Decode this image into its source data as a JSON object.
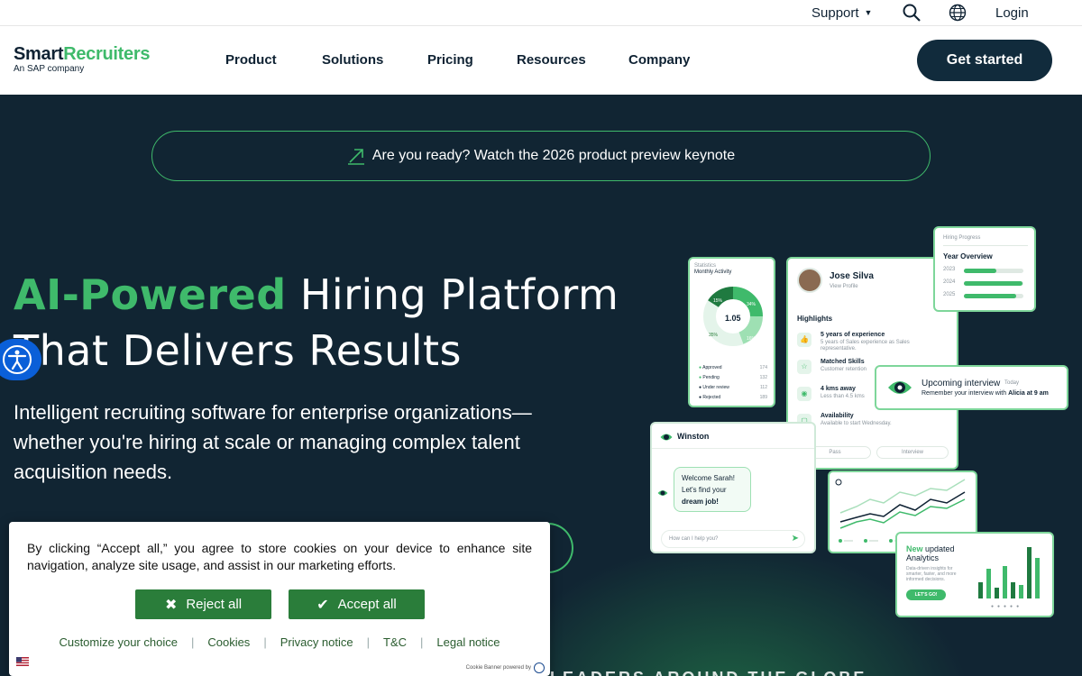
{
  "utility": {
    "support": "Support",
    "login": "Login"
  },
  "logo": {
    "part1": "Smart",
    "part2": "Recruiters",
    "tagline": "An SAP company"
  },
  "nav": {
    "items": [
      "Product",
      "Solutions",
      "Pricing",
      "Resources",
      "Company"
    ],
    "cta": "Get started"
  },
  "hero": {
    "banner": "Are you ready? Watch the 2026 product preview keynote",
    "headline_green": "AI-Powered",
    "headline_rest": " Hiring Platform",
    "headline_line2": "That Delivers Results",
    "subtitle": "Intelligent recruiting software for enterprise organizations—whether you're hiring at scale or managing complex talent acquisition needs.",
    "stats_peek": "LEADERS AROUND THE GLOBE"
  },
  "illustration": {
    "stat": {
      "label": "Statistics",
      "title": "Monthly Activity",
      "center_value": "1.05",
      "center_sub": "Relevance stack",
      "segments": [
        "15%",
        "34%",
        "35%",
        "16%"
      ],
      "rows": [
        {
          "label": "Approved",
          "value": "174"
        },
        {
          "label": "Pending",
          "value": "132"
        },
        {
          "label": "Under review",
          "value": "112"
        },
        {
          "label": "Rejected",
          "value": "189"
        }
      ]
    },
    "profile": {
      "name": "Jose Silva",
      "view": "View Profile",
      "highlights_title": "Highlights",
      "items": [
        {
          "title": "5 years of experience",
          "desc": "5 years of Sales experience as Sales representative."
        },
        {
          "title": "Matched Skills",
          "desc": "Customer retention"
        },
        {
          "title": "4 kms away",
          "desc": "Less than 4.5 kms"
        },
        {
          "title": "Availability",
          "desc": "Available to start Wednesday."
        }
      ],
      "pass": "Pass",
      "interview": "Interview"
    },
    "progress": {
      "label": "Hiring Progress",
      "title": "Year Overview",
      "years": [
        {
          "year": "2023",
          "pct": 0.55
        },
        {
          "year": "2024",
          "pct": 0.98
        },
        {
          "year": "2025",
          "pct": 0.88
        }
      ]
    },
    "interview": {
      "title": "Upcoming interview",
      "when": "Today",
      "desc_prefix": "Remember your interview with ",
      "desc_bold": "Alicia at 9 am"
    },
    "chat": {
      "bot": "Winston",
      "msg1": "Welcome Sarah!",
      "msg2": "Let's find your",
      "msg3": "dream job!",
      "placeholder": "How can I help you?"
    },
    "analytics": {
      "title_green": "New",
      "title_rest": " updated",
      "title_line2": "Analytics",
      "desc": "Data-driven insights for smarter, faster, and more informed decisions.",
      "button": "LET'S GO!",
      "bars": [
        0.3,
        0.55,
        0.2,
        0.6,
        0.3,
        0.25,
        0.95,
        0.75
      ]
    }
  },
  "cookie": {
    "text": "By clicking “Accept all,” you agree to store cookies on your device to enhance site navigation, analyze site usage, and assist in our marketing efforts.",
    "reject": "Reject all",
    "accept": "Accept all",
    "links": [
      "Customize your choice",
      "Cookies",
      "Privacy notice",
      "T&C",
      "Legal notice"
    ],
    "powered": "Cookie Banner powered by"
  },
  "colors": {
    "brand_green": "#3fba6b",
    "navy": "#112b3c",
    "cookie_green": "#2a7d3a"
  }
}
